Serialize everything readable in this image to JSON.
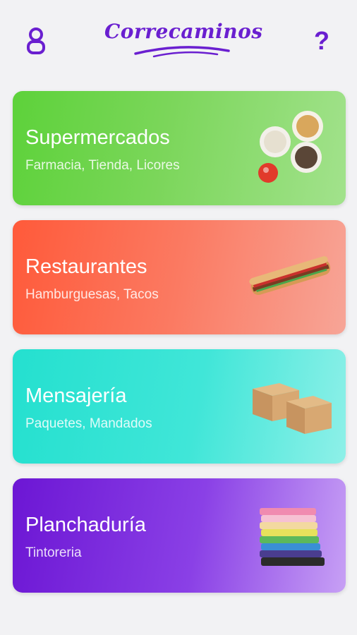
{
  "header": {
    "logo_text": "Correcaminos",
    "user_icon": "user-icon",
    "help_icon": "help-icon",
    "help_glyph": "?"
  },
  "colors": {
    "brand_purple": "#6a1fd0",
    "background": "#f2f2f4"
  },
  "categories": [
    {
      "title": "Supermercados",
      "subtitle": "Farmacia, Tienda, Licores",
      "image": "spice-bowls-image",
      "color": "#5dd23a"
    },
    {
      "title": "Restaurantes",
      "subtitle": "Hamburguesas, Tacos",
      "image": "sandwich-image",
      "color": "#ff5a3a"
    },
    {
      "title": "Mensajería",
      "subtitle": "Paquetes, Mandados",
      "image": "boxes-image",
      "color": "#24e0cf"
    },
    {
      "title": "Planchaduría",
      "subtitle": "Tintoreria",
      "image": "folded-clothes-image",
      "color": "#6c16d4"
    }
  ]
}
